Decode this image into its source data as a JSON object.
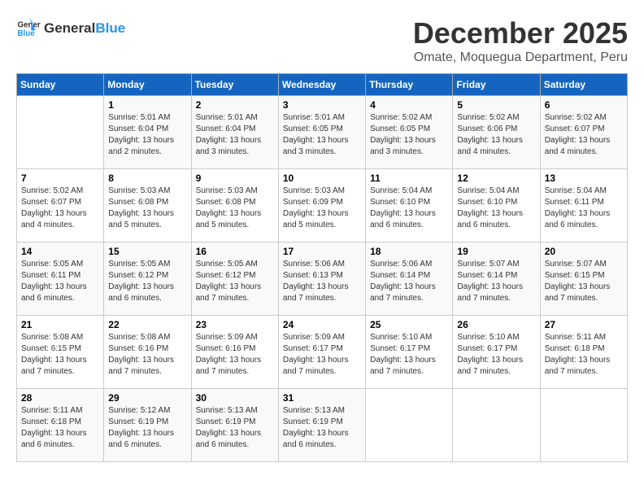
{
  "header": {
    "logo_general": "General",
    "logo_blue": "Blue",
    "month_title": "December 2025",
    "location": "Omate, Moquegua Department, Peru"
  },
  "days_of_week": [
    "Sunday",
    "Monday",
    "Tuesday",
    "Wednesday",
    "Thursday",
    "Friday",
    "Saturday"
  ],
  "weeks": [
    [
      {
        "day": "",
        "info": ""
      },
      {
        "day": "1",
        "info": "Sunrise: 5:01 AM\nSunset: 6:04 PM\nDaylight: 13 hours\nand 2 minutes."
      },
      {
        "day": "2",
        "info": "Sunrise: 5:01 AM\nSunset: 6:04 PM\nDaylight: 13 hours\nand 3 minutes."
      },
      {
        "day": "3",
        "info": "Sunrise: 5:01 AM\nSunset: 6:05 PM\nDaylight: 13 hours\nand 3 minutes."
      },
      {
        "day": "4",
        "info": "Sunrise: 5:02 AM\nSunset: 6:05 PM\nDaylight: 13 hours\nand 3 minutes."
      },
      {
        "day": "5",
        "info": "Sunrise: 5:02 AM\nSunset: 6:06 PM\nDaylight: 13 hours\nand 4 minutes."
      },
      {
        "day": "6",
        "info": "Sunrise: 5:02 AM\nSunset: 6:07 PM\nDaylight: 13 hours\nand 4 minutes."
      }
    ],
    [
      {
        "day": "7",
        "info": "Sunrise: 5:02 AM\nSunset: 6:07 PM\nDaylight: 13 hours\nand 4 minutes."
      },
      {
        "day": "8",
        "info": "Sunrise: 5:03 AM\nSunset: 6:08 PM\nDaylight: 13 hours\nand 5 minutes."
      },
      {
        "day": "9",
        "info": "Sunrise: 5:03 AM\nSunset: 6:08 PM\nDaylight: 13 hours\nand 5 minutes."
      },
      {
        "day": "10",
        "info": "Sunrise: 5:03 AM\nSunset: 6:09 PM\nDaylight: 13 hours\nand 5 minutes."
      },
      {
        "day": "11",
        "info": "Sunrise: 5:04 AM\nSunset: 6:10 PM\nDaylight: 13 hours\nand 6 minutes."
      },
      {
        "day": "12",
        "info": "Sunrise: 5:04 AM\nSunset: 6:10 PM\nDaylight: 13 hours\nand 6 minutes."
      },
      {
        "day": "13",
        "info": "Sunrise: 5:04 AM\nSunset: 6:11 PM\nDaylight: 13 hours\nand 6 minutes."
      }
    ],
    [
      {
        "day": "14",
        "info": "Sunrise: 5:05 AM\nSunset: 6:11 PM\nDaylight: 13 hours\nand 6 minutes."
      },
      {
        "day": "15",
        "info": "Sunrise: 5:05 AM\nSunset: 6:12 PM\nDaylight: 13 hours\nand 6 minutes."
      },
      {
        "day": "16",
        "info": "Sunrise: 5:05 AM\nSunset: 6:12 PM\nDaylight: 13 hours\nand 7 minutes."
      },
      {
        "day": "17",
        "info": "Sunrise: 5:06 AM\nSunset: 6:13 PM\nDaylight: 13 hours\nand 7 minutes."
      },
      {
        "day": "18",
        "info": "Sunrise: 5:06 AM\nSunset: 6:14 PM\nDaylight: 13 hours\nand 7 minutes."
      },
      {
        "day": "19",
        "info": "Sunrise: 5:07 AM\nSunset: 6:14 PM\nDaylight: 13 hours\nand 7 minutes."
      },
      {
        "day": "20",
        "info": "Sunrise: 5:07 AM\nSunset: 6:15 PM\nDaylight: 13 hours\nand 7 minutes."
      }
    ],
    [
      {
        "day": "21",
        "info": "Sunrise: 5:08 AM\nSunset: 6:15 PM\nDaylight: 13 hours\nand 7 minutes."
      },
      {
        "day": "22",
        "info": "Sunrise: 5:08 AM\nSunset: 6:16 PM\nDaylight: 13 hours\nand 7 minutes."
      },
      {
        "day": "23",
        "info": "Sunrise: 5:09 AM\nSunset: 6:16 PM\nDaylight: 13 hours\nand 7 minutes."
      },
      {
        "day": "24",
        "info": "Sunrise: 5:09 AM\nSunset: 6:17 PM\nDaylight: 13 hours\nand 7 minutes."
      },
      {
        "day": "25",
        "info": "Sunrise: 5:10 AM\nSunset: 6:17 PM\nDaylight: 13 hours\nand 7 minutes."
      },
      {
        "day": "26",
        "info": "Sunrise: 5:10 AM\nSunset: 6:17 PM\nDaylight: 13 hours\nand 7 minutes."
      },
      {
        "day": "27",
        "info": "Sunrise: 5:11 AM\nSunset: 6:18 PM\nDaylight: 13 hours\nand 7 minutes."
      }
    ],
    [
      {
        "day": "28",
        "info": "Sunrise: 5:11 AM\nSunset: 6:18 PM\nDaylight: 13 hours\nand 6 minutes."
      },
      {
        "day": "29",
        "info": "Sunrise: 5:12 AM\nSunset: 6:19 PM\nDaylight: 13 hours\nand 6 minutes."
      },
      {
        "day": "30",
        "info": "Sunrise: 5:13 AM\nSunset: 6:19 PM\nDaylight: 13 hours\nand 6 minutes."
      },
      {
        "day": "31",
        "info": "Sunrise: 5:13 AM\nSunset: 6:19 PM\nDaylight: 13 hours\nand 6 minutes."
      },
      {
        "day": "",
        "info": ""
      },
      {
        "day": "",
        "info": ""
      },
      {
        "day": "",
        "info": ""
      }
    ]
  ]
}
